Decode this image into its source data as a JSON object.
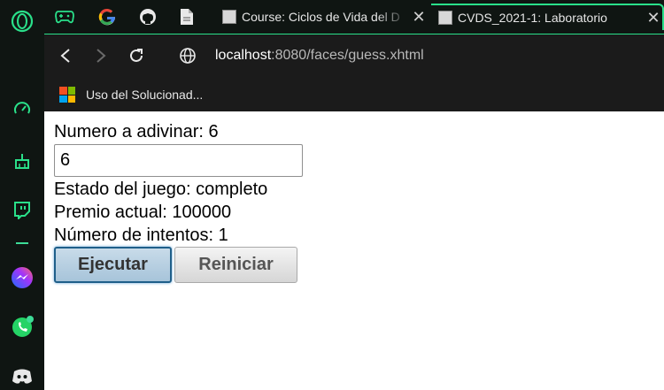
{
  "browser": {
    "tabs": [
      {
        "title": "Course: Ciclos de Vida del D",
        "close": "✕"
      },
      {
        "title": "CVDS_2021-1: Laboratorio",
        "close": "✕"
      }
    ],
    "url_host": "localhost",
    "url_rest": ":8080/faces/guess.xhtml",
    "bookmark_label": "Uso del Solucionad..."
  },
  "game": {
    "number_line": "Numero a adivinar: 6",
    "input_value": "6",
    "status_line": "Estado del juego: completo",
    "prize_line": "Premio actual: 100000",
    "attempts_line": "Número de intentos: 1",
    "execute_label": "Ejecutar",
    "reset_label": "Reiniciar"
  },
  "colors": {
    "accent": "#2ae08a",
    "sidebar_bg": "#0f1512",
    "toolbar_bg": "#1b1b1b"
  }
}
